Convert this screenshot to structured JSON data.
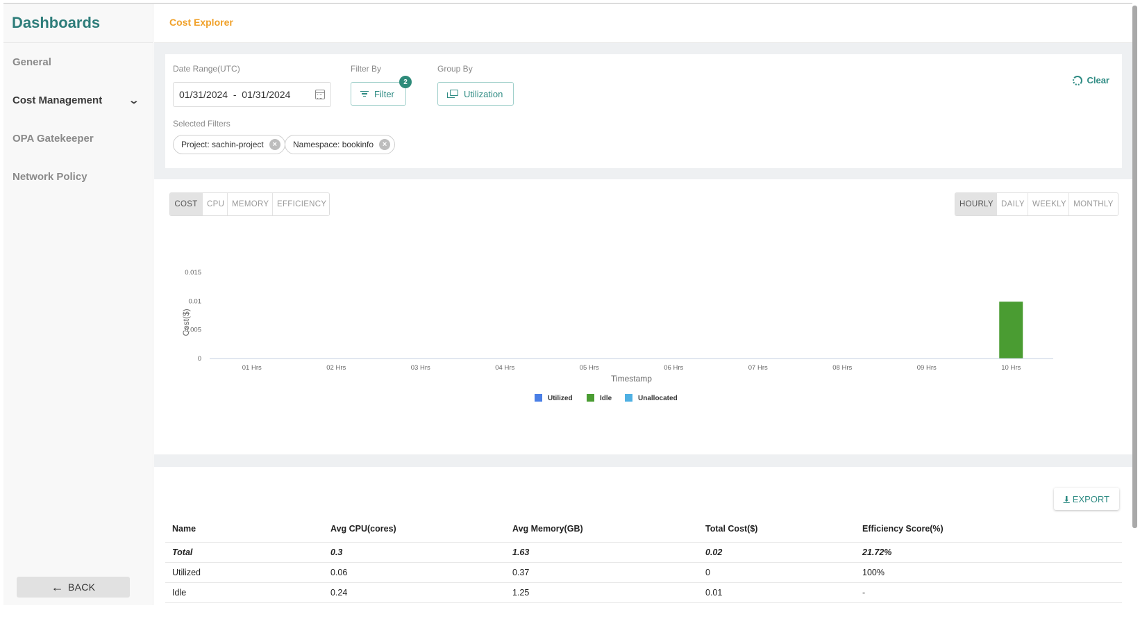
{
  "sidebar": {
    "brand": "Dashboards",
    "items": [
      {
        "label": "General",
        "active": false
      },
      {
        "label": "Cost Management",
        "active": true,
        "expandable": true
      },
      {
        "label": "OPA Gatekeeper",
        "active": false
      },
      {
        "label": "Network Policy",
        "active": false
      }
    ],
    "back_label": "BACK"
  },
  "header": {
    "title": "Cost Explorer"
  },
  "filters": {
    "date_range_label": "Date Range(UTC)",
    "date_range_value": "01/31/2024  -  01/31/2024",
    "filter_by_label": "Filter By",
    "filter_button": "Filter",
    "filter_count": "2",
    "group_by_label": "Group By",
    "group_by_value": "Utilization",
    "clear_label": "Clear",
    "selected_filters_label": "Selected Filters",
    "chips": [
      "Project: sachin-project",
      "Namespace: bookinfo"
    ]
  },
  "metric_tabs": [
    "COST",
    "CPU",
    "MEMORY",
    "EFFICIENCY"
  ],
  "metric_tab_active": "COST",
  "period_tabs": [
    "HOURLY",
    "DAILY",
    "WEEKLY",
    "MONTHLY"
  ],
  "period_tab_active": "HOURLY",
  "colors": {
    "accent": "#2e8b83",
    "title": "#f0a12a",
    "utilized": "#4a7fe6",
    "idle": "#4a9c32",
    "unallocated": "#4fb0e3"
  },
  "chart_data": {
    "type": "bar",
    "stacked": true,
    "title": "",
    "xlabel": "Timestamp",
    "ylabel": "Cost($)",
    "categories": [
      "01 Hrs",
      "02 Hrs",
      "03 Hrs",
      "04 Hrs",
      "05 Hrs",
      "06 Hrs",
      "07 Hrs",
      "08 Hrs",
      "09 Hrs",
      "10 Hrs"
    ],
    "series": [
      {
        "name": "Utilized",
        "values": [
          0,
          0,
          0,
          0,
          0,
          0,
          0,
          0,
          0,
          0
        ]
      },
      {
        "name": "Idle",
        "values": [
          0,
          0,
          0,
          0,
          0,
          0,
          0,
          0,
          0,
          0.0099
        ]
      },
      {
        "name": "Unallocated",
        "values": [
          0,
          0,
          0,
          0,
          0,
          0,
          0,
          0,
          0,
          0
        ]
      }
    ],
    "yticks": [
      "0",
      "0.005",
      "0.01",
      "0.015"
    ],
    "ylim": [
      0,
      0.015
    ],
    "grid": false,
    "legend": "bottom-center"
  },
  "table": {
    "export_label": "EXPORT",
    "columns": [
      "Name",
      "Avg CPU(cores)",
      "Avg Memory(GB)",
      "Total Cost($)",
      "Efficiency Score(%)"
    ],
    "rows": [
      [
        "Total",
        "0.3",
        "1.63",
        "0.02",
        "21.72%"
      ],
      [
        "Utilized",
        "0.06",
        "0.37",
        "0",
        "100%"
      ],
      [
        "Idle",
        "0.24",
        "1.25",
        "0.01",
        "-"
      ]
    ]
  }
}
